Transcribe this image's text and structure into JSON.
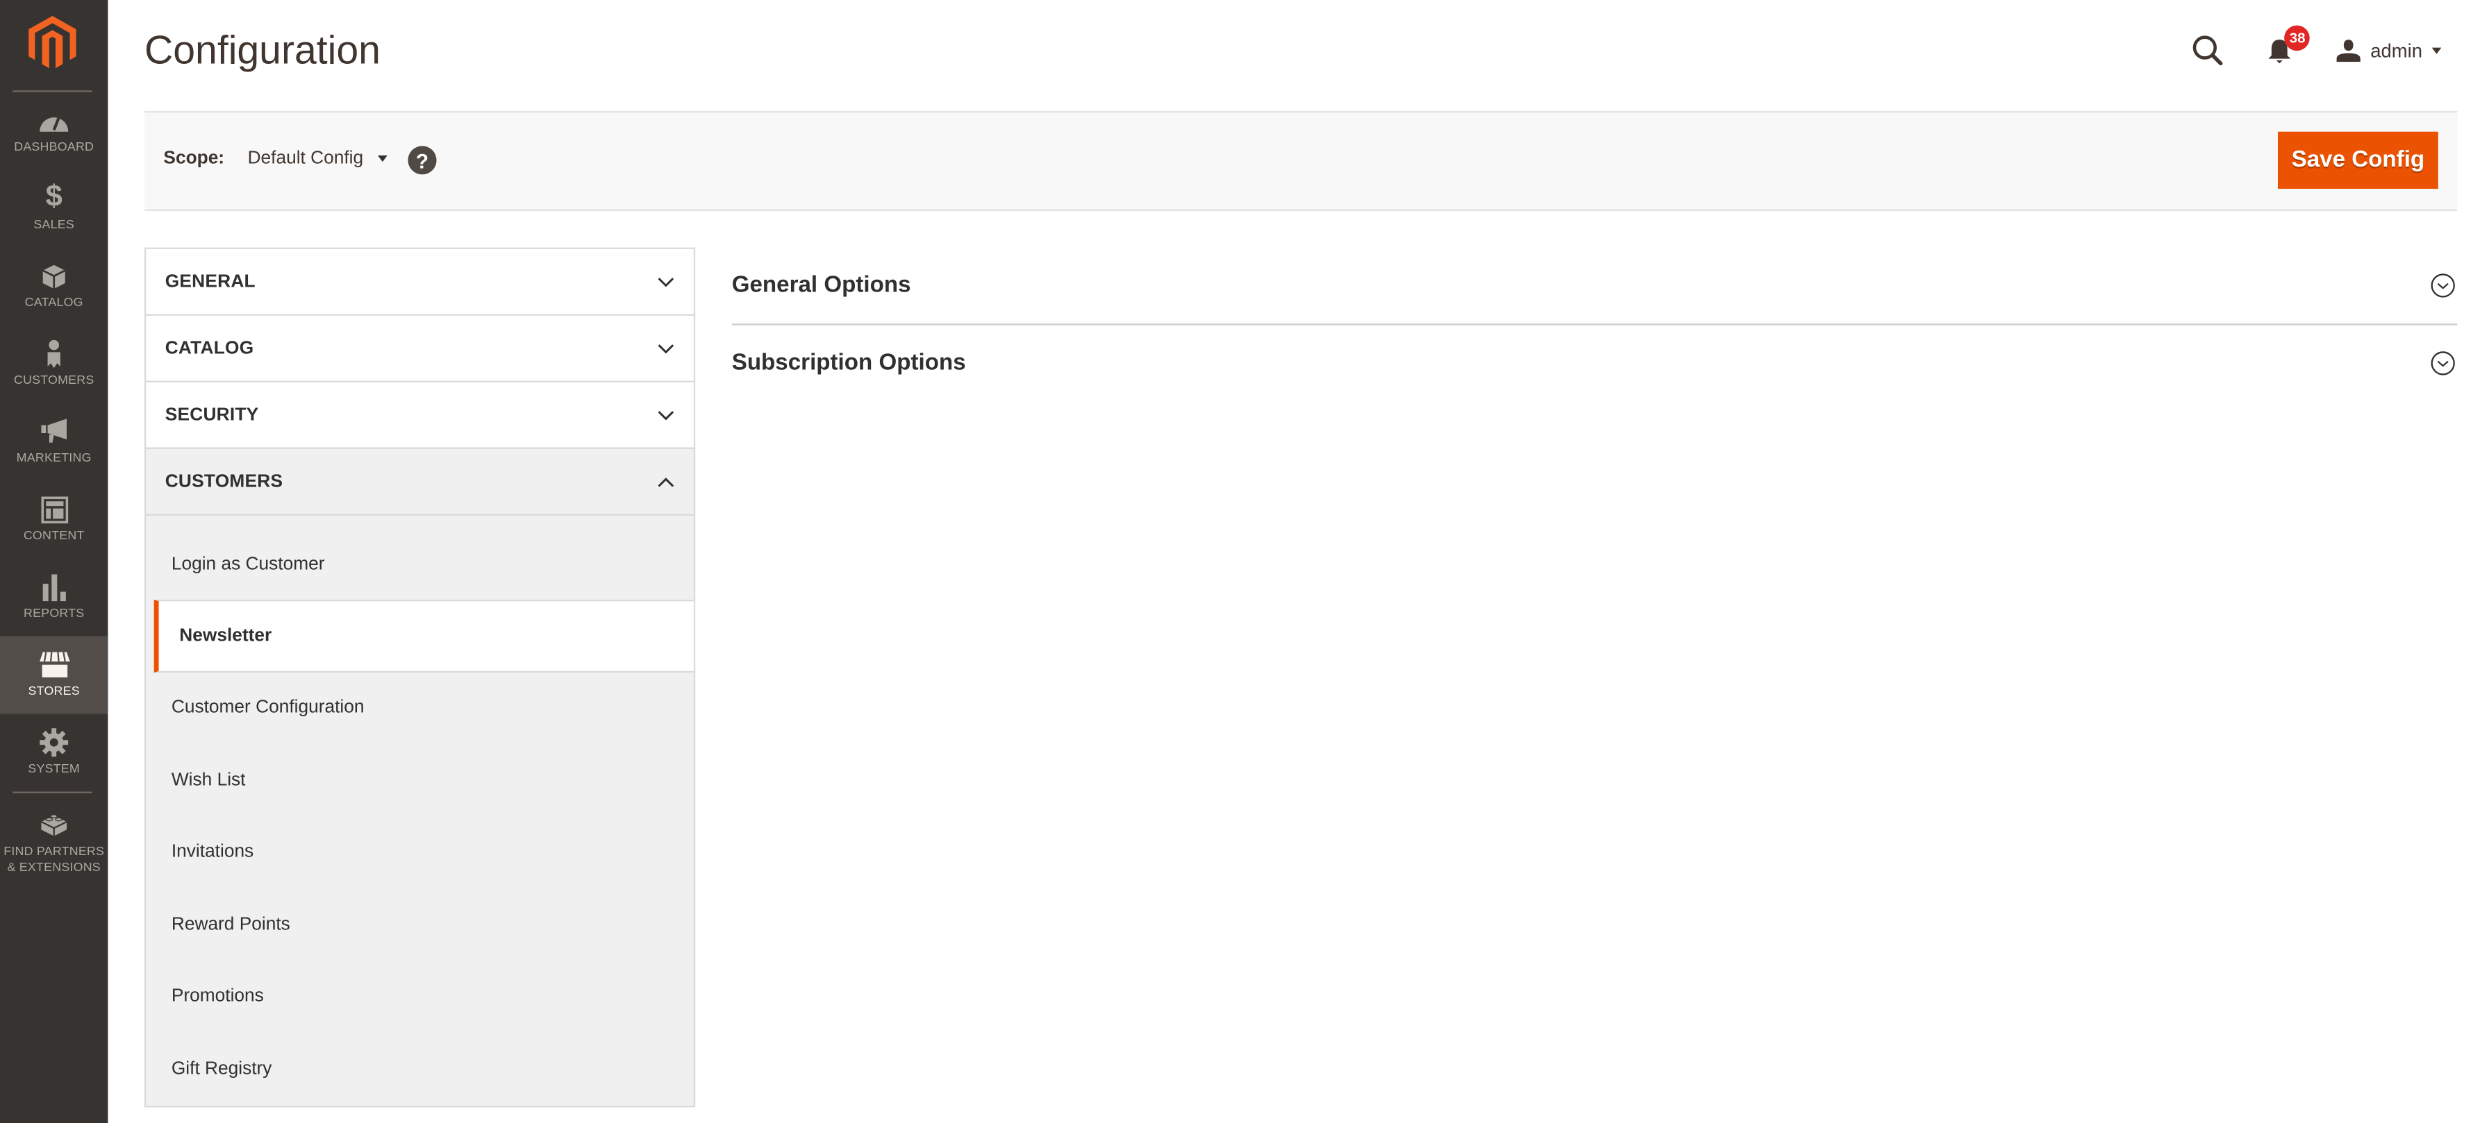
{
  "menu": {
    "items": [
      {
        "label": "DASHBOARD",
        "icon": "dashboard-icon",
        "active": false
      },
      {
        "label": "SALES",
        "icon": "dollar-icon",
        "active": false
      },
      {
        "label": "CATALOG",
        "icon": "box-icon",
        "active": false
      },
      {
        "label": "CUSTOMERS",
        "icon": "person-icon",
        "active": false
      },
      {
        "label": "MARKETING",
        "icon": "megaphone-icon",
        "active": false
      },
      {
        "label": "CONTENT",
        "icon": "layout-icon",
        "active": false
      },
      {
        "label": "REPORTS",
        "icon": "bar-chart-icon",
        "active": false
      },
      {
        "label": "STORES",
        "icon": "storefront-icon",
        "active": true
      },
      {
        "label": "SYSTEM",
        "icon": "gear-icon",
        "active": false
      },
      {
        "label": "FIND PARTNERS & EXTENSIONS",
        "icon": "lego-brick-icon",
        "active": false
      }
    ]
  },
  "header": {
    "title": "Configuration",
    "notifications_count": "38",
    "user_name": "admin"
  },
  "scope": {
    "label": "Scope:",
    "value": "Default Config",
    "help": "?"
  },
  "actions": {
    "save_label": "Save Config"
  },
  "tabs": [
    {
      "title": "GENERAL",
      "open": false
    },
    {
      "title": "CATALOG",
      "open": false
    },
    {
      "title": "SECURITY",
      "open": false
    },
    {
      "title": "CUSTOMERS",
      "open": true,
      "items": [
        {
          "label": "Login as Customer",
          "active": false
        },
        {
          "label": "Newsletter",
          "active": true
        },
        {
          "label": "Customer Configuration",
          "active": false
        },
        {
          "label": "Wish List",
          "active": false
        },
        {
          "label": "Invitations",
          "active": false
        },
        {
          "label": "Reward Points",
          "active": false
        },
        {
          "label": "Promotions",
          "active": false
        },
        {
          "label": "Gift Registry",
          "active": false
        }
      ]
    }
  ],
  "sections": [
    {
      "title": "General Options",
      "expanded": false
    },
    {
      "title": "Subscription Options",
      "expanded": false
    }
  ],
  "colors": {
    "accent": "#eb5202",
    "menu_bg": "#373330",
    "menu_active_bg": "#524d49",
    "badge": "#e22626"
  }
}
